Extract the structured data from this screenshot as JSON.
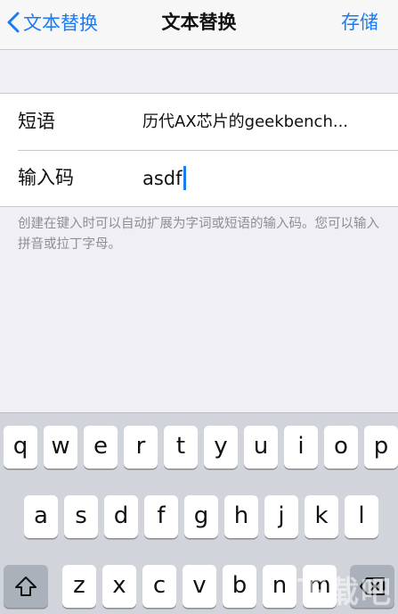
{
  "navbar": {
    "back_label": "文本替换",
    "title": "文本替换",
    "save_label": "存储"
  },
  "form": {
    "phrase_label": "短语",
    "phrase_value": "历代AX芯片的geekbench...",
    "shortcut_label": "输入码",
    "shortcut_value": "asdf"
  },
  "hint": "创建在键入时可以自动扩展为字词或短语的输入码。您可以输入拼音或拉丁字母。",
  "keyboard": {
    "row1": [
      "q",
      "w",
      "e",
      "r",
      "t",
      "y",
      "u",
      "i",
      "o",
      "p"
    ],
    "row2": [
      "a",
      "s",
      "d",
      "f",
      "g",
      "h",
      "j",
      "k",
      "l"
    ],
    "row3": [
      "z",
      "x",
      "c",
      "v",
      "b",
      "n",
      "m"
    ],
    "icons": {
      "shift": "shift-icon",
      "delete": "delete-icon"
    }
  },
  "watermark": "下载吧",
  "colors": {
    "accent": "#1a7cf5",
    "background": "#efeff4",
    "keyboard": "#d1d4da"
  }
}
